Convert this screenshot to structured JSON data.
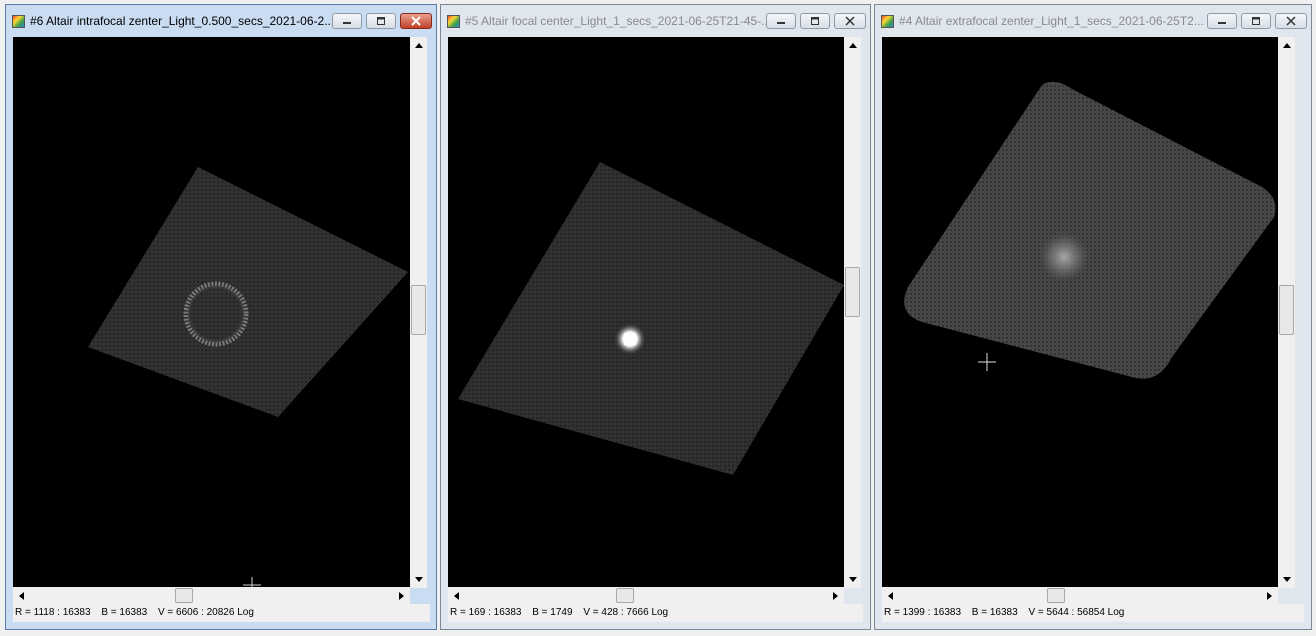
{
  "windows": [
    {
      "title": "#6 Altair intrafocal zenter_Light_0.500_secs_2021-06-2...",
      "active": true,
      "status": {
        "r": "R = 1118 : 16383",
        "b": "B = 16383",
        "v": "V = 6606 : 20826 Log"
      }
    },
    {
      "title": "#5 Altair focal center_Light_1_secs_2021-06-25T21-45-...",
      "active": false,
      "status": {
        "r": "R = 169 : 16383",
        "b": "B = 1749",
        "v": "V = 428 : 7666 Log"
      }
    },
    {
      "title": "#4 Altair extrafocal zenter_Light_1_secs_2021-06-25T2...",
      "active": false,
      "status": {
        "r": "R = 1399 : 16383",
        "b": "B = 16383",
        "v": "V = 5644 : 56854 Log"
      }
    }
  ],
  "icons": {
    "app": "gradient-image-icon",
    "minimize": "minimize-icon",
    "maximize": "maximize-icon",
    "close": "close-icon",
    "crosshair": "crosshair-cursor-icon"
  }
}
